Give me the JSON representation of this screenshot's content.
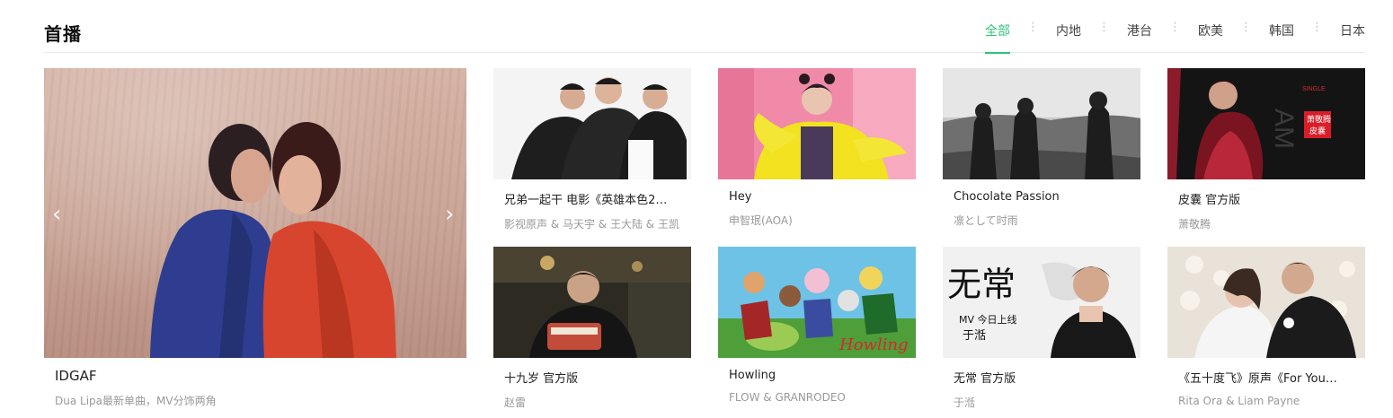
{
  "section": {
    "title": "首播",
    "tabs": [
      {
        "label": "全部",
        "active": true
      },
      {
        "label": "内地",
        "active": false
      },
      {
        "label": "港台",
        "active": false
      },
      {
        "label": "欧美",
        "active": false
      },
      {
        "label": "韩国",
        "active": false
      },
      {
        "label": "日本",
        "active": false
      }
    ],
    "separator": "⋮"
  },
  "feature": {
    "title": "IDGAF",
    "desc": "Dua Lipa最新单曲，MV分饰两角",
    "prev_icon": "‹",
    "next_icon": "›"
  },
  "cards": [
    {
      "name": "兄弟一起干 电影《英雄本色2…",
      "artist": "影视原声 & 马天宇 & 王大陆 & 王凯"
    },
    {
      "name": "Hey",
      "artist": "申智珉(AOA)"
    },
    {
      "name": "Chocolate Passion",
      "artist": "凛として时雨"
    },
    {
      "name": "皮囊 官方版",
      "artist": "萧敬腾"
    },
    {
      "name": "十九岁 官方版",
      "artist": "赵雷"
    },
    {
      "name": "Howling",
      "artist": "FLOW & GRANRODEO"
    },
    {
      "name": "无常 官方版",
      "artist": "于湉"
    },
    {
      "name": "《五十度飞》原声《For You…",
      "artist": "Rita Ora & Liam Payne"
    }
  ],
  "thumb_text": {
    "skin_badge": "萧敬腾\n皮囊",
    "single": "SINGLE",
    "wuchang": "无常",
    "mv_release": "MV 今日上线",
    "yutian": "于湉",
    "howling": "Howling"
  },
  "colors": {
    "accent": "#31c27c",
    "text": "#222222",
    "muted": "#999999"
  }
}
